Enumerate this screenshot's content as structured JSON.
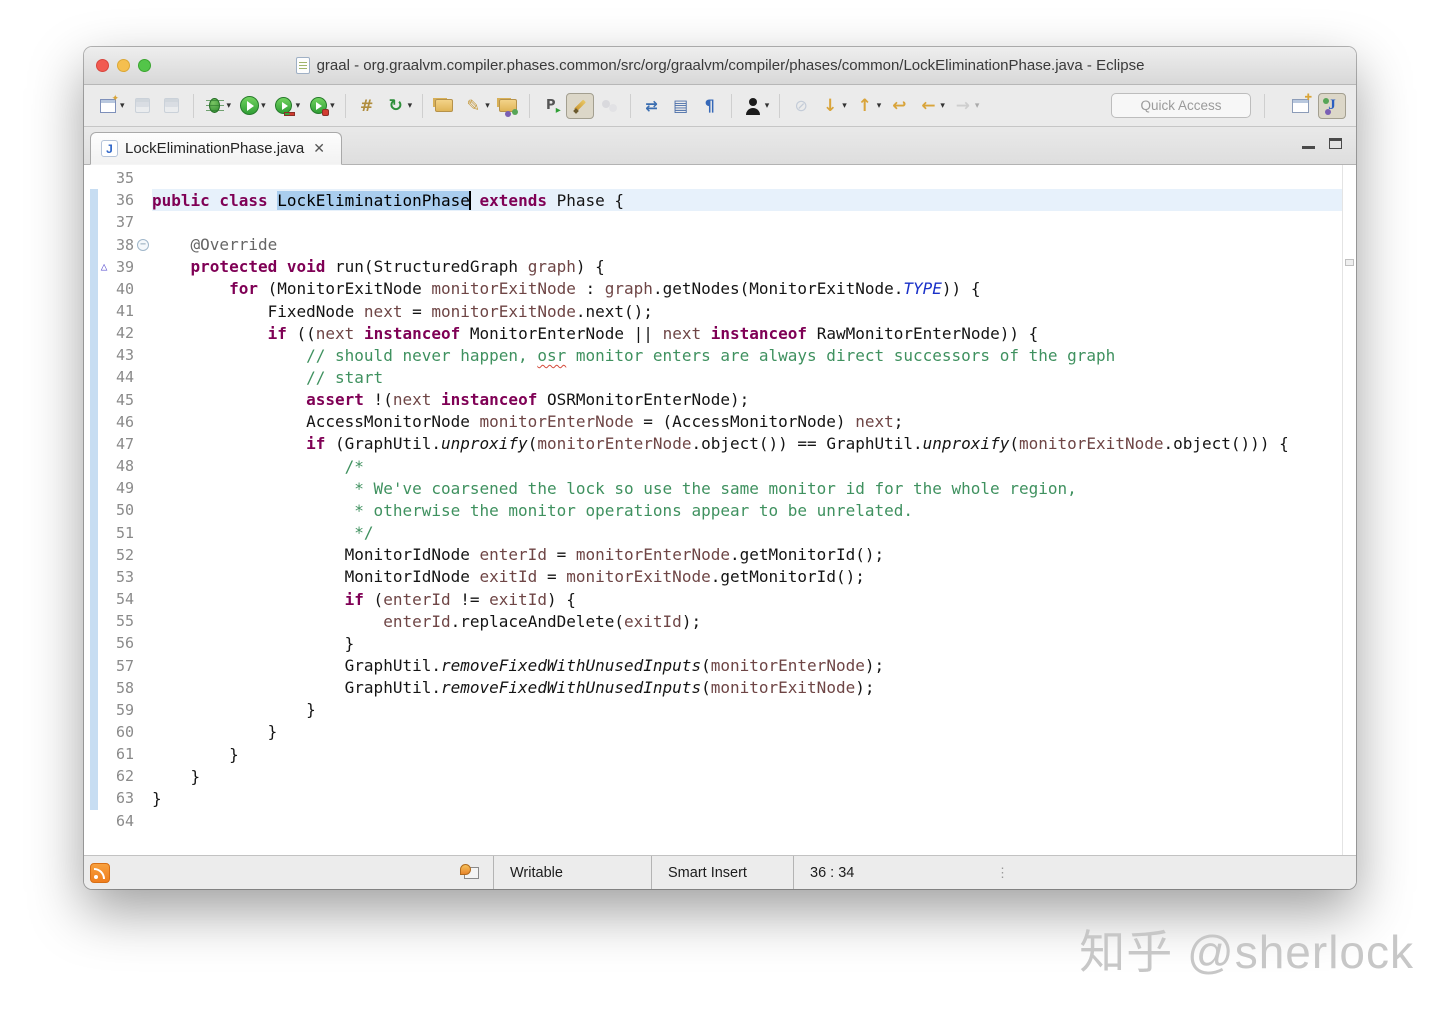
{
  "window": {
    "title": "graal - org.graalvm.compiler.phases.common/src/org/graalvm/compiler/phases/common/LockEliminationPhase.java - Eclipse"
  },
  "toolbar": {
    "quick_access_placeholder": "Quick Access",
    "items": [
      {
        "name": "new-wizard",
        "cls": "new-wizard",
        "glyph": "",
        "dropdown": true
      },
      {
        "name": "save",
        "cls": "save",
        "glyph": "",
        "disabled": true
      },
      {
        "name": "save-all",
        "cls": "save",
        "glyph": "",
        "disabled": true
      },
      {
        "sep": true
      },
      {
        "name": "debug",
        "cls": "bug",
        "glyph": "",
        "dropdown": true
      },
      {
        "name": "run",
        "cls": "run-circle",
        "glyph": "",
        "dropdown": true
      },
      {
        "name": "coverage",
        "cls": "run-circle small-run coverage",
        "glyph": "",
        "badge": true,
        "dropdown": true
      },
      {
        "name": "profile",
        "cls": "run-circle small-run profile",
        "glyph": "",
        "badge": true,
        "dropdown": true
      },
      {
        "sep": true
      },
      {
        "name": "new-java-project",
        "cls": "grid-star",
        "glyph": "#"
      },
      {
        "name": "update-project",
        "cls": "refresh",
        "glyph": "↻",
        "dropdown": true
      },
      {
        "sep": true
      },
      {
        "name": "open-task",
        "cls": "folder",
        "glyph": ""
      },
      {
        "name": "search-pencil",
        "cls": "pencil",
        "glyph": "✎",
        "dropdown": true
      },
      {
        "name": "open-type-folder",
        "cls": "folder folder-pkg",
        "glyph": ""
      },
      {
        "sep": true
      },
      {
        "name": "plugin-navigate",
        "cls": "plug",
        "glyph": "P"
      },
      {
        "name": "format-brush",
        "cls": "brush",
        "glyph": "",
        "selected": true
      },
      {
        "name": "occurrences-toggle",
        "cls": "dots",
        "glyph": "",
        "disabled": true
      },
      {
        "sep": true
      },
      {
        "name": "link-with-editor",
        "cls": "link2",
        "glyph": "⇄"
      },
      {
        "name": "show-documents",
        "cls": "doclist",
        "glyph": "▤"
      },
      {
        "name": "show-whitespace",
        "cls": "pilcrow",
        "glyph": "¶"
      },
      {
        "sep": true
      },
      {
        "name": "user-account",
        "cls": "user",
        "glyph": "",
        "dropdown": true
      },
      {
        "sep": true
      },
      {
        "name": "pin-editor",
        "cls": "pin",
        "glyph": "⊘",
        "disabled": true
      },
      {
        "name": "next-annotation",
        "cls": "gold-arrow",
        "glyph": "↓",
        "dropdown": true
      },
      {
        "name": "previous-annotation",
        "cls": "gold-arrow",
        "glyph": "↑",
        "dropdown": true
      },
      {
        "name": "last-edit-location",
        "cls": "gold-arrow",
        "glyph": "↩"
      },
      {
        "name": "back-history",
        "cls": "gold-arrow",
        "glyph": "←",
        "dropdown": true
      },
      {
        "name": "forward-history",
        "cls": "gray-arrow",
        "glyph": "→",
        "disabled": true,
        "dropdown": true
      }
    ],
    "perspectives": [
      {
        "name": "open-perspective",
        "cls": "persp-open",
        "glyph": ""
      },
      {
        "name": "java-perspective",
        "cls": "persp-java",
        "glyph": "J",
        "selected": true
      }
    ]
  },
  "tab": {
    "file_icon_letter": "J",
    "label": "LockEliminationPhase.java",
    "close_glyph": "✕"
  },
  "editor": {
    "colors": {
      "keyword": "#7f0055",
      "comment": "#3f915f",
      "variable": "#6e4545",
      "static_field": "#1a31c8",
      "selection": "#a9cdee",
      "line_highlight": "#e7f1fb",
      "range_bar": "#c7ddf2"
    },
    "lines": [
      {
        "n": 35,
        "seg": []
      },
      {
        "n": 36,
        "hl": true,
        "range": true,
        "seg": [
          [
            "k",
            "public class "
          ],
          [
            "sel",
            "LockEliminationPhase"
          ],
          [
            "caret",
            ""
          ],
          [
            "p",
            " "
          ],
          [
            "k",
            "extends"
          ],
          [
            "p",
            " Phase {"
          ]
        ]
      },
      {
        "n": 37,
        "range": true,
        "seg": []
      },
      {
        "n": 38,
        "range": true,
        "fold": "minus",
        "seg": [
          [
            "a",
            "    @Override"
          ]
        ]
      },
      {
        "n": 39,
        "range": true,
        "ann": "override-triangle",
        "seg": [
          [
            "k",
            "    protected void "
          ],
          [
            "p",
            "run(StructuredGraph "
          ],
          [
            "v",
            "graph"
          ],
          [
            "p",
            ") {"
          ]
        ]
      },
      {
        "n": 40,
        "range": true,
        "seg": [
          [
            "k",
            "        for"
          ],
          [
            "p",
            " (MonitorExitNode "
          ],
          [
            "v",
            "monitorExitNode"
          ],
          [
            "p",
            " : "
          ],
          [
            "v",
            "graph"
          ],
          [
            "p",
            ".getNodes(MonitorExitNode."
          ],
          [
            "sf",
            "TYPE"
          ],
          [
            "p",
            ")) {"
          ]
        ]
      },
      {
        "n": 41,
        "range": true,
        "seg": [
          [
            "p",
            "            FixedNode "
          ],
          [
            "v",
            "next"
          ],
          [
            "p",
            " = "
          ],
          [
            "v",
            "monitorExitNode"
          ],
          [
            "p",
            ".next();"
          ]
        ]
      },
      {
        "n": 42,
        "range": true,
        "seg": [
          [
            "k",
            "            if"
          ],
          [
            "p",
            " (("
          ],
          [
            "v",
            "next"
          ],
          [
            "p",
            " "
          ],
          [
            "k",
            "instanceof"
          ],
          [
            "p",
            " MonitorEnterNode || "
          ],
          [
            "v",
            "next"
          ],
          [
            "p",
            " "
          ],
          [
            "k",
            "instanceof"
          ],
          [
            "p",
            " RawMonitorEnterNode)) {"
          ]
        ]
      },
      {
        "n": 43,
        "range": true,
        "seg": [
          [
            "c",
            "                // should never happen, "
          ],
          [
            "cm",
            "osr"
          ],
          [
            "c",
            " monitor enters are always direct successors of the graph"
          ]
        ]
      },
      {
        "n": 44,
        "range": true,
        "seg": [
          [
            "c",
            "                // start"
          ]
        ]
      },
      {
        "n": 45,
        "range": true,
        "seg": [
          [
            "k",
            "                assert"
          ],
          [
            "p",
            " !("
          ],
          [
            "v",
            "next"
          ],
          [
            "p",
            " "
          ],
          [
            "k",
            "instanceof"
          ],
          [
            "p",
            " OSRMonitorEnterNode);"
          ]
        ]
      },
      {
        "n": 46,
        "range": true,
        "seg": [
          [
            "p",
            "                AccessMonitorNode "
          ],
          [
            "v",
            "monitorEnterNode"
          ],
          [
            "p",
            " = (AccessMonitorNode) "
          ],
          [
            "v",
            "next"
          ],
          [
            "p",
            ";"
          ]
        ]
      },
      {
        "n": 47,
        "range": true,
        "seg": [
          [
            "k",
            "                if"
          ],
          [
            "p",
            " (GraphUtil."
          ],
          [
            "sm",
            "unproxify"
          ],
          [
            "p",
            "("
          ],
          [
            "v",
            "monitorEnterNode"
          ],
          [
            "p",
            ".object()) == GraphUtil."
          ],
          [
            "sm",
            "unproxify"
          ],
          [
            "p",
            "("
          ],
          [
            "v",
            "monitorExitNode"
          ],
          [
            "p",
            ".object())) {"
          ]
        ]
      },
      {
        "n": 48,
        "range": true,
        "seg": [
          [
            "c",
            "                    /*"
          ]
        ]
      },
      {
        "n": 49,
        "range": true,
        "seg": [
          [
            "c",
            "                     * We've coarsened the lock so use the same monitor id for the whole region,"
          ]
        ]
      },
      {
        "n": 50,
        "range": true,
        "seg": [
          [
            "c",
            "                     * otherwise the monitor operations appear to be unrelated."
          ]
        ]
      },
      {
        "n": 51,
        "range": true,
        "seg": [
          [
            "c",
            "                     */"
          ]
        ]
      },
      {
        "n": 52,
        "range": true,
        "seg": [
          [
            "p",
            "                    MonitorIdNode "
          ],
          [
            "v",
            "enterId"
          ],
          [
            "p",
            " = "
          ],
          [
            "v",
            "monitorEnterNode"
          ],
          [
            "p",
            ".getMonitorId();"
          ]
        ]
      },
      {
        "n": 53,
        "range": true,
        "seg": [
          [
            "p",
            "                    MonitorIdNode "
          ],
          [
            "v",
            "exitId"
          ],
          [
            "p",
            " = "
          ],
          [
            "v",
            "monitorExitNode"
          ],
          [
            "p",
            ".getMonitorId();"
          ]
        ]
      },
      {
        "n": 54,
        "range": true,
        "seg": [
          [
            "k",
            "                    if"
          ],
          [
            "p",
            " ("
          ],
          [
            "v",
            "enterId"
          ],
          [
            "p",
            " != "
          ],
          [
            "v",
            "exitId"
          ],
          [
            "p",
            ") {"
          ]
        ]
      },
      {
        "n": 55,
        "range": true,
        "seg": [
          [
            "v",
            "                        enterId"
          ],
          [
            "p",
            ".replaceAndDelete("
          ],
          [
            "v",
            "exitId"
          ],
          [
            "p",
            ");"
          ]
        ]
      },
      {
        "n": 56,
        "range": true,
        "seg": [
          [
            "p",
            "                    }"
          ]
        ]
      },
      {
        "n": 57,
        "range": true,
        "seg": [
          [
            "p",
            "                    GraphUtil."
          ],
          [
            "sm",
            "removeFixedWithUnusedInputs"
          ],
          [
            "p",
            "("
          ],
          [
            "v",
            "monitorEnterNode"
          ],
          [
            "p",
            ");"
          ]
        ]
      },
      {
        "n": 58,
        "range": true,
        "seg": [
          [
            "p",
            "                    GraphUtil."
          ],
          [
            "sm",
            "removeFixedWithUnusedInputs"
          ],
          [
            "p",
            "("
          ],
          [
            "v",
            "monitorExitNode"
          ],
          [
            "p",
            ");"
          ]
        ]
      },
      {
        "n": 59,
        "range": true,
        "seg": [
          [
            "p",
            "                }"
          ]
        ]
      },
      {
        "n": 60,
        "range": true,
        "seg": [
          [
            "p",
            "            }"
          ]
        ]
      },
      {
        "n": 61,
        "range": true,
        "seg": [
          [
            "p",
            "        }"
          ]
        ]
      },
      {
        "n": 62,
        "range": true,
        "seg": [
          [
            "p",
            "    }"
          ]
        ]
      },
      {
        "n": 63,
        "range": true,
        "seg": [
          [
            "p",
            "}"
          ]
        ]
      },
      {
        "n": 64,
        "seg": []
      }
    ]
  },
  "status": {
    "writable": "Writable",
    "insert_mode": "Smart Insert",
    "cursor_position": "36 : 34",
    "trim_dots": "⋮"
  },
  "watermark": "知乎 @sherlock"
}
